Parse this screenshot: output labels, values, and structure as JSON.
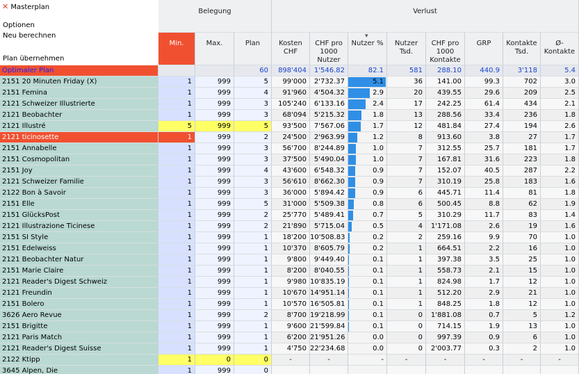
{
  "menu": {
    "title": "Masterplan",
    "options": "Optionen",
    "recalc": "Neu berechnen",
    "apply": "Plan übernehmen"
  },
  "groups": {
    "belegung": "Belegung",
    "verlust": "Verlust"
  },
  "columns": [
    "Min.",
    "Max.",
    "Plan",
    "Kosten CHF",
    "CHF pro 1000 Nutzer",
    "Nutzer %",
    "Nutzer Tsd.",
    "CHF pro 1000 Kontakte",
    "GRP",
    "Kontakte Tsd.",
    "Ø-Kontakte"
  ],
  "optimal": {
    "name": "Optimaler Plan",
    "min": "",
    "max": "",
    "plan": "60",
    "kosten": "898'404",
    "chf_nutzer": "1'546.82",
    "nutzer_pct": "82.1",
    "nutzer_tsd": "581",
    "chf_kontakte": "288.10",
    "grp": "440.9",
    "kontakte": "3'118",
    "okontakte": "5.4"
  },
  "rows": [
    {
      "name": "2151 20 Minuten Friday (X)",
      "min": "1",
      "max": "999",
      "plan": "5",
      "kosten": "99'000",
      "chf_nutzer": "2'732.37",
      "nutzer_pct": "5.1",
      "nutzer_tsd": "36",
      "chf_kontakte": "141.00",
      "grp": "99.3",
      "kontakte": "702",
      "okontakte": "3.0",
      "bar": 5.1,
      "hl": ""
    },
    {
      "name": "2151 Femina",
      "min": "1",
      "max": "999",
      "plan": "4",
      "kosten": "91'960",
      "chf_nutzer": "4'504.32",
      "nutzer_pct": "2.9",
      "nutzer_tsd": "20",
      "chf_kontakte": "439.55",
      "grp": "29.6",
      "kontakte": "209",
      "okontakte": "2.5",
      "bar": 2.9,
      "hl": ""
    },
    {
      "name": "2121 Schweizer Illustrierte",
      "min": "1",
      "max": "999",
      "plan": "3",
      "kosten": "105'240",
      "chf_nutzer": "6'133.16",
      "nutzer_pct": "2.4",
      "nutzer_tsd": "17",
      "chf_kontakte": "242.25",
      "grp": "61.4",
      "kontakte": "434",
      "okontakte": "2.1",
      "bar": 2.4,
      "hl": ""
    },
    {
      "name": "2121 Beobachter",
      "min": "1",
      "max": "999",
      "plan": "3",
      "kosten": "68'094",
      "chf_nutzer": "5'215.32",
      "nutzer_pct": "1.8",
      "nutzer_tsd": "13",
      "chf_kontakte": "288.56",
      "grp": "33.4",
      "kontakte": "236",
      "okontakte": "1.8",
      "bar": 1.8,
      "hl": ""
    },
    {
      "name": "2121 Illustré",
      "min": "5",
      "max": "999",
      "plan": "5",
      "kosten": "93'500",
      "chf_nutzer": "7'567.06",
      "nutzer_pct": "1.7",
      "nutzer_tsd": "12",
      "chf_kontakte": "481.84",
      "grp": "27.4",
      "kontakte": "194",
      "okontakte": "2.6",
      "bar": 1.7,
      "hl": "yellow"
    },
    {
      "name": "2121 ticinosette",
      "min": "1",
      "max": "999",
      "plan": "2",
      "kosten": "24'500",
      "chf_nutzer": "2'963.99",
      "nutzer_pct": "1.2",
      "nutzer_tsd": "8",
      "chf_kontakte": "913.60",
      "grp": "3.8",
      "kontakte": "27",
      "okontakte": "1.7",
      "bar": 1.2,
      "hl": "red"
    },
    {
      "name": "2151 Annabelle",
      "min": "1",
      "max": "999",
      "plan": "3",
      "kosten": "56'700",
      "chf_nutzer": "8'244.89",
      "nutzer_pct": "1.0",
      "nutzer_tsd": "7",
      "chf_kontakte": "312.55",
      "grp": "25.7",
      "kontakte": "181",
      "okontakte": "1.7",
      "bar": 1.0,
      "hl": ""
    },
    {
      "name": "2151 Cosmopolitan",
      "min": "1",
      "max": "999",
      "plan": "3",
      "kosten": "37'500",
      "chf_nutzer": "5'490.04",
      "nutzer_pct": "1.0",
      "nutzer_tsd": "7",
      "chf_kontakte": "167.81",
      "grp": "31.6",
      "kontakte": "223",
      "okontakte": "1.8",
      "bar": 1.0,
      "hl": ""
    },
    {
      "name": "2151 Joy",
      "min": "1",
      "max": "999",
      "plan": "4",
      "kosten": "43'600",
      "chf_nutzer": "6'548.32",
      "nutzer_pct": "0.9",
      "nutzer_tsd": "7",
      "chf_kontakte": "152.07",
      "grp": "40.5",
      "kontakte": "287",
      "okontakte": "2.2",
      "bar": 0.9,
      "hl": ""
    },
    {
      "name": "2121 Schweizer Familie",
      "min": "1",
      "max": "999",
      "plan": "3",
      "kosten": "56'610",
      "chf_nutzer": "8'662.30",
      "nutzer_pct": "0.9",
      "nutzer_tsd": "7",
      "chf_kontakte": "310.19",
      "grp": "25.8",
      "kontakte": "183",
      "okontakte": "1.6",
      "bar": 0.9,
      "hl": ""
    },
    {
      "name": "2122 Bon à Savoir",
      "min": "1",
      "max": "999",
      "plan": "3",
      "kosten": "36'000",
      "chf_nutzer": "5'894.42",
      "nutzer_pct": "0.9",
      "nutzer_tsd": "6",
      "chf_kontakte": "445.71",
      "grp": "11.4",
      "kontakte": "81",
      "okontakte": "1.8",
      "bar": 0.9,
      "hl": ""
    },
    {
      "name": "2151 Elle",
      "min": "1",
      "max": "999",
      "plan": "5",
      "kosten": "31'000",
      "chf_nutzer": "5'509.38",
      "nutzer_pct": "0.8",
      "nutzer_tsd": "6",
      "chf_kontakte": "500.45",
      "grp": "8.8",
      "kontakte": "62",
      "okontakte": "1.9",
      "bar": 0.8,
      "hl": ""
    },
    {
      "name": "2151 GlücksPost",
      "min": "1",
      "max": "999",
      "plan": "2",
      "kosten": "25'770",
      "chf_nutzer": "5'489.41",
      "nutzer_pct": "0.7",
      "nutzer_tsd": "5",
      "chf_kontakte": "310.29",
      "grp": "11.7",
      "kontakte": "83",
      "okontakte": "1.4",
      "bar": 0.7,
      "hl": ""
    },
    {
      "name": "2121 Illustrazione Ticinese",
      "min": "1",
      "max": "999",
      "plan": "2",
      "kosten": "21'890",
      "chf_nutzer": "5'715.04",
      "nutzer_pct": "0.5",
      "nutzer_tsd": "4",
      "chf_kontakte": "1'171.08",
      "grp": "2.6",
      "kontakte": "19",
      "okontakte": "1.6",
      "bar": 0.5,
      "hl": ""
    },
    {
      "name": "2151 SI Style",
      "min": "1",
      "max": "999",
      "plan": "1",
      "kosten": "18'200",
      "chf_nutzer": "10'508.83",
      "nutzer_pct": "0.2",
      "nutzer_tsd": "2",
      "chf_kontakte": "259.16",
      "grp": "9.9",
      "kontakte": "70",
      "okontakte": "1.0",
      "bar": 0.2,
      "hl": ""
    },
    {
      "name": "2151 Edelweiss",
      "min": "1",
      "max": "999",
      "plan": "1",
      "kosten": "10'370",
      "chf_nutzer": "8'605.79",
      "nutzer_pct": "0.2",
      "nutzer_tsd": "1",
      "chf_kontakte": "664.51",
      "grp": "2.2",
      "kontakte": "16",
      "okontakte": "1.0",
      "bar": 0.2,
      "hl": ""
    },
    {
      "name": "2121 Beobachter Natur",
      "min": "1",
      "max": "999",
      "plan": "1",
      "kosten": "9'800",
      "chf_nutzer": "9'449.40",
      "nutzer_pct": "0.1",
      "nutzer_tsd": "1",
      "chf_kontakte": "397.38",
      "grp": "3.5",
      "kontakte": "25",
      "okontakte": "1.0",
      "bar": 0.1,
      "hl": ""
    },
    {
      "name": "2151 Marie Claire",
      "min": "1",
      "max": "999",
      "plan": "1",
      "kosten": "8'200",
      "chf_nutzer": "8'040.55",
      "nutzer_pct": "0.1",
      "nutzer_tsd": "1",
      "chf_kontakte": "558.73",
      "grp": "2.1",
      "kontakte": "15",
      "okontakte": "1.0",
      "bar": 0.1,
      "hl": ""
    },
    {
      "name": "2121 Reader's Digest Schweiz",
      "min": "1",
      "max": "999",
      "plan": "1",
      "kosten": "9'980",
      "chf_nutzer": "10'835.19",
      "nutzer_pct": "0.1",
      "nutzer_tsd": "1",
      "chf_kontakte": "824.98",
      "grp": "1.7",
      "kontakte": "12",
      "okontakte": "1.0",
      "bar": 0.1,
      "hl": ""
    },
    {
      "name": "2121 Freundin",
      "min": "1",
      "max": "999",
      "plan": "1",
      "kosten": "10'670",
      "chf_nutzer": "14'951.14",
      "nutzer_pct": "0.1",
      "nutzer_tsd": "1",
      "chf_kontakte": "512.20",
      "grp": "2.9",
      "kontakte": "21",
      "okontakte": "1.0",
      "bar": 0.1,
      "hl": ""
    },
    {
      "name": "2151 Bolero",
      "min": "1",
      "max": "999",
      "plan": "1",
      "kosten": "10'570",
      "chf_nutzer": "16'505.81",
      "nutzer_pct": "0.1",
      "nutzer_tsd": "1",
      "chf_kontakte": "848.25",
      "grp": "1.8",
      "kontakte": "12",
      "okontakte": "1.0",
      "bar": 0.1,
      "hl": ""
    },
    {
      "name": "3626 Aero Revue",
      "min": "1",
      "max": "999",
      "plan": "2",
      "kosten": "8'700",
      "chf_nutzer": "19'218.99",
      "nutzer_pct": "0.1",
      "nutzer_tsd": "0",
      "chf_kontakte": "1'881.08",
      "grp": "0.7",
      "kontakte": "5",
      "okontakte": "1.2",
      "bar": 0.1,
      "hl": ""
    },
    {
      "name": "2151 Brigitte",
      "min": "1",
      "max": "999",
      "plan": "1",
      "kosten": "9'600",
      "chf_nutzer": "21'599.84",
      "nutzer_pct": "0.1",
      "nutzer_tsd": "0",
      "chf_kontakte": "714.15",
      "grp": "1.9",
      "kontakte": "13",
      "okontakte": "1.0",
      "bar": 0.1,
      "hl": ""
    },
    {
      "name": "2121 Paris Match",
      "min": "1",
      "max": "999",
      "plan": "1",
      "kosten": "6'200",
      "chf_nutzer": "21'951.26",
      "nutzer_pct": "0.0",
      "nutzer_tsd": "0",
      "chf_kontakte": "997.39",
      "grp": "0.9",
      "kontakte": "6",
      "okontakte": "1.0",
      "bar": 0.0,
      "hl": ""
    },
    {
      "name": "2121 Reader's Digest Suisse",
      "min": "1",
      "max": "999",
      "plan": "1",
      "kosten": "4'750",
      "chf_nutzer": "22'234.68",
      "nutzer_pct": "0.0",
      "nutzer_tsd": "0",
      "chf_kontakte": "2'003.77",
      "grp": "0.3",
      "kontakte": "2",
      "okontakte": "1.0",
      "bar": 0.0,
      "hl": ""
    },
    {
      "name": "2122 Ktipp",
      "min": "1",
      "max": "0",
      "plan": "0",
      "kosten": "-",
      "chf_nutzer": "-",
      "nutzer_pct": "-",
      "nutzer_tsd": "-",
      "chf_kontakte": "-",
      "grp": "-",
      "kontakte": "-",
      "okontakte": "-",
      "bar": 0,
      "hl": "yellow3"
    },
    {
      "name": "3645 Alpen, Die",
      "min": "1",
      "max": "999",
      "plan": "0",
      "kosten": "",
      "chf_nutzer": "",
      "nutzer_pct": "",
      "nutzer_tsd": "",
      "chf_kontakte": "",
      "grp": "",
      "kontakte": "",
      "okontakte": "",
      "bar": 0,
      "hl": ""
    }
  ],
  "colors": {
    "accent_red": "#f05030",
    "bar_blue": "#2f8fe6",
    "highlight_yellow": "#ffff66",
    "name_bg": "#b9d9d2"
  }
}
